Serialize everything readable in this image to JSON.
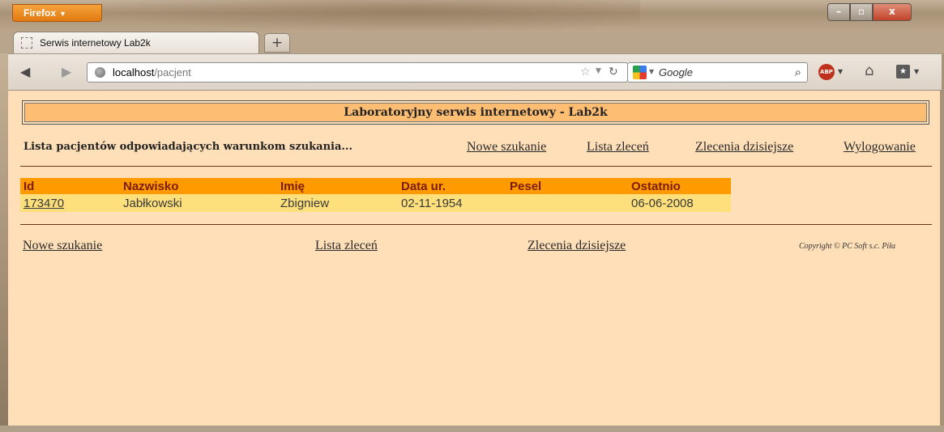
{
  "window": {
    "app_button": "Firefox",
    "controls": {
      "minimize": "–",
      "maximize": "▫",
      "close": "x"
    }
  },
  "tabs": [
    {
      "title": "Serwis internetowy Lab2k"
    }
  ],
  "newtab_label": "+",
  "navbar": {
    "url_host": "localhost",
    "url_path": "/pacjent",
    "search_placeholder": "Google"
  },
  "page": {
    "header": "Laboratoryjny serwis internetowy - Lab2k",
    "subtitle": "Lista pacjentów odpowiadających warunkom szukania...",
    "top_links": {
      "new_search": "Nowe szukanie",
      "order_list": "Lista zleceń",
      "today_orders": "Zlecenia dzisiejsze",
      "logout": "Wylogowanie"
    },
    "table": {
      "columns": [
        "Id",
        "Nazwisko",
        "Imię",
        "Data ur.",
        "Pesel",
        "Ostatnio"
      ],
      "rows": [
        {
          "id": "173470",
          "surname": "Jabłkowski",
          "name": "Zbigniew",
          "birth": "02-11-1954",
          "pesel": "",
          "last": "06-06-2008"
        }
      ]
    },
    "bottom_links": {
      "new_search": "Nowe szukanie",
      "order_list": "Lista zleceń",
      "today_orders": "Zlecenia dzisiejsze"
    },
    "copyright": "Copyright © PC Soft s.c. Piła"
  },
  "colors": {
    "page_bg": "#ffdfb8",
    "header_bg": "#fdbe74",
    "table_header_bg": "#ff9a00",
    "table_row_bg": "#fde07c"
  }
}
